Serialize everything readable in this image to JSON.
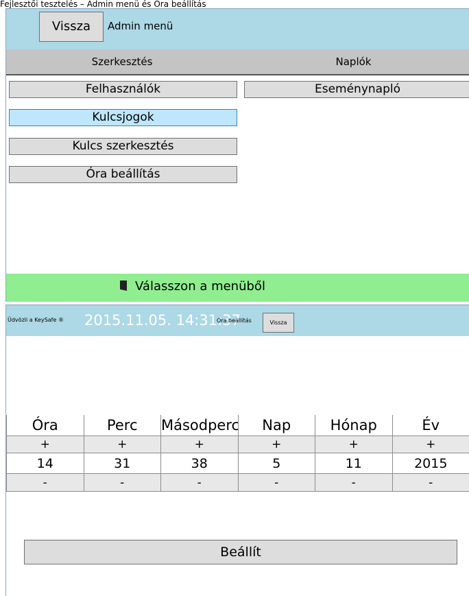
{
  "caption": "Fejlesztői tesztelés – Admin menü és Óra beállítás",
  "admin": {
    "back_label": "Vissza",
    "title": "Admin menü",
    "tabs": [
      "Szerkesztés",
      "Naplók"
    ],
    "left_menu": [
      "Felhasználók",
      "Kulcsjogok",
      "Kulcs szerkesztés",
      "Óra beállítás"
    ],
    "right_menu": [
      "Eseménynapló"
    ],
    "selected_item": "Kulcsjogok",
    "status_text": "Válasszon a menüből",
    "status_icon": "door-icon"
  },
  "clock": {
    "welcome": "Üdvözli a KeySafe ®",
    "datetime": "2015.11.05. 14:31:37",
    "title": "Óra beállítás",
    "back_label": "Vissza",
    "headers": [
      "Óra",
      "Perc",
      "Másodperc",
      "Nap",
      "Hónap",
      "Év"
    ],
    "plus": [
      "+",
      "+",
      "+",
      "+",
      "+",
      "+"
    ],
    "values": [
      "14",
      "31",
      "38",
      "5",
      "11",
      "2015"
    ],
    "minus": [
      "-",
      "-",
      "-",
      "-",
      "-",
      "-"
    ],
    "set_label": "Beállít"
  },
  "colors": {
    "header": "#add8e6",
    "tabs": "#c4c4c4",
    "status": "#90ee90",
    "selected": "#bee6fd",
    "button": "#dddddd"
  }
}
